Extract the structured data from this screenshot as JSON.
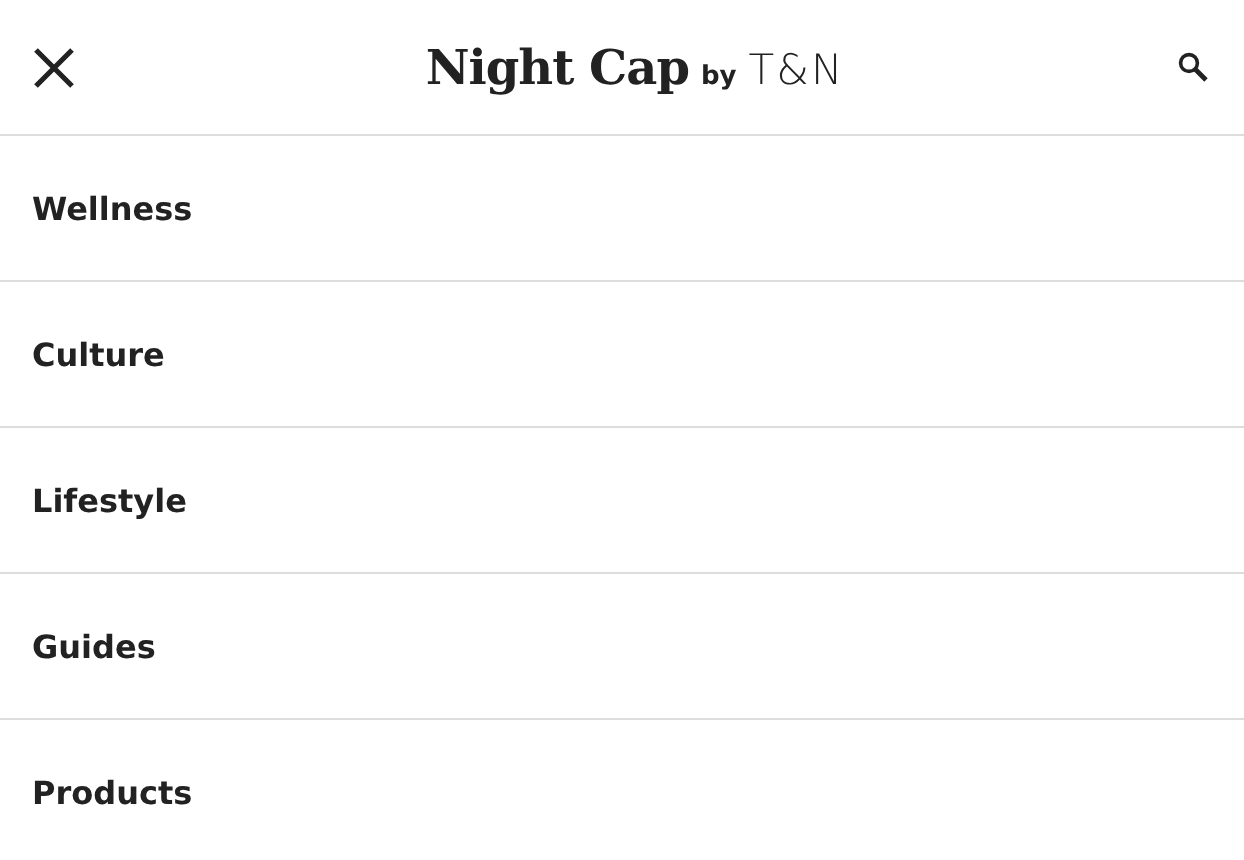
{
  "header": {
    "logo": {
      "title": "Night Cap",
      "by": "by",
      "brand": "T&N"
    }
  },
  "menu": [
    {
      "label": "Wellness"
    },
    {
      "label": "Culture"
    },
    {
      "label": "Lifestyle"
    },
    {
      "label": "Guides"
    },
    {
      "label": "Products"
    }
  ]
}
